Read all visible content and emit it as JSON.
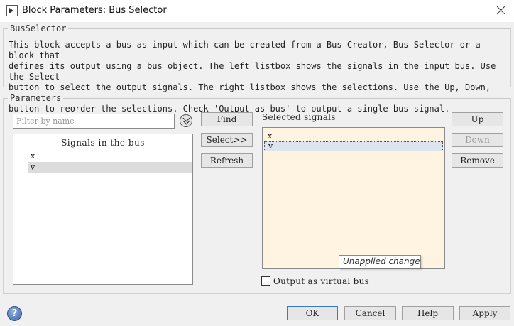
{
  "window": {
    "title": "Block Parameters: Bus Selector"
  },
  "block": {
    "group_label": "BusSelector",
    "description": "This block accepts a bus as input which can be created from a Bus Creator, Bus Selector or a block that\ndefines its output using a bus object. The left listbox shows the signals in the input bus. Use the Select\nbutton to select the output signals. The right listbox shows the selections. Use the Up, Down, or Remove\nbutton to reorder the selections. Check 'Output as bus' to output a single bus signal."
  },
  "parameters": {
    "group_label": "Parameters",
    "filter": {
      "placeholder": "Filter by name",
      "value": ""
    },
    "signals_header": "Signals in the bus",
    "signals": [
      "x",
      "v"
    ],
    "selected_signal_index": 1,
    "buttons": {
      "find": "Find",
      "select": "Select>>",
      "refresh": "Refresh",
      "up": "Up",
      "down": "Down",
      "remove": "Remove"
    },
    "selected_label": "Selected signals",
    "selected_signals": [
      "x",
      "v"
    ],
    "tooltip": "Unapplied change",
    "output_virtual_bus": {
      "label": "Output as virtual bus",
      "checked": false
    }
  },
  "footer": {
    "ok": "OK",
    "cancel": "Cancel",
    "help": "Help",
    "apply": "Apply",
    "help_icon": "?"
  },
  "colors": {
    "selected_list_bg": "#fff3e1",
    "default_button_border": "#3a78c8"
  }
}
